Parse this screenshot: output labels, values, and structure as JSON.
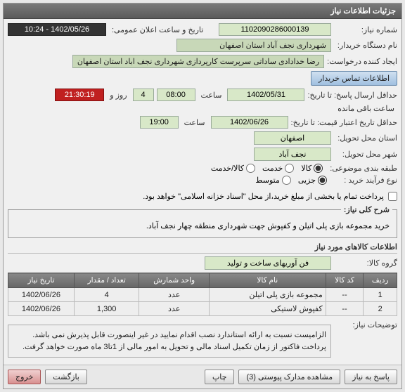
{
  "window": {
    "title": "جزئیات اطلاعات نیاز"
  },
  "header": {
    "need_no_label": "شماره نیاز:",
    "need_no": "1102090286000139",
    "announce_label": "تاریخ و ساعت اعلان عمومی:",
    "announce": "1402/05/26 - 10:24",
    "buyer_label": "نام دستگاه خریدار:",
    "buyer": "شهرداری نجف آباد استان اصفهان",
    "requester_label": "ایجاد کننده درخواست:",
    "requester": "رضا خدادادی ساداتی سرپرست  کارپردازی شهرداری نجف اباد استان اصفهان",
    "contact_label": "اطلاعات تماس خریدار",
    "deadline_label": "حداقل ارسال پاسخ: تا تاریخ:",
    "deadline_date": "1402/05/31",
    "deadline_time": "08:00",
    "days_label": "روز و",
    "days": "4",
    "time_left": "21:30:19",
    "time_left_label": "ساعت باقی مانده",
    "valid_label": "حداقل تاریخ اعتبار قیمت: تا تاریخ:",
    "valid_date": "1402/06/26",
    "valid_time": "19:00",
    "province_label": "استان محل تحویل:",
    "province": "اصفهان",
    "city_label": "شهر محل تحویل:",
    "city": "نجف آباد",
    "group_label": "طبقه بندی موضوعی:",
    "group_goods": "کالا",
    "group_service": "خدمت",
    "group_both": "کالا/خدمت",
    "process_label": "نوع فرآیند خرید :",
    "process_minor": "جزیی",
    "process_medium": "متوسط",
    "pay_note": "پرداخت تمام یا بخشی از مبلغ خرید،از محل \"اسناد خزانه اسلامی\" خواهد بود.",
    "time_label": "ساعت"
  },
  "need": {
    "legend": "شرح کلی نیاز:",
    "text": "خرید مجموعه بازی پلی اتیلن و کفپوش جهت شهرداری منطقه چهار نجف آباد."
  },
  "items": {
    "section": "اطلاعات کالاهای مورد نیاز",
    "group_label": "گروه کالا:",
    "group": "فن آوریهای ساخت و تولید",
    "cols": {
      "row": "ردیف",
      "code": "کد کالا",
      "name": "نام کالا",
      "unit": "واحد شمارش",
      "qty": "تعداد / مقدار",
      "date": "تاریخ نیاز"
    },
    "rows": [
      {
        "row": "1",
        "code": "--",
        "name": "مجموعه بازی پلی اتیلن",
        "unit": "عدد",
        "qty": "4",
        "date": "1402/06/26"
      },
      {
        "row": "2",
        "code": "--",
        "name": "کفپوش لاستیکی",
        "unit": "عدد",
        "qty": "1,300",
        "date": "1402/06/26"
      }
    ]
  },
  "notes": {
    "label": "توضیحات نیاز:",
    "line1": "الزامیست نسبت به ارائه استاندارد نصب اقدام نمایید در غیر اینصورت قابل پذیرش نمی باشد.",
    "line2": "پرداخت فاکتور از زمان تکمیل اسناد مالی و تحویل به امور مالی از 1تا3 ماه صورت خواهد گرفت."
  },
  "buttons": {
    "reply": "پاسخ به نیاز",
    "attach": "مشاهده مدارک پیوستی (3)",
    "print": "چاپ",
    "back": "بازگشت",
    "exit": "خروج"
  }
}
